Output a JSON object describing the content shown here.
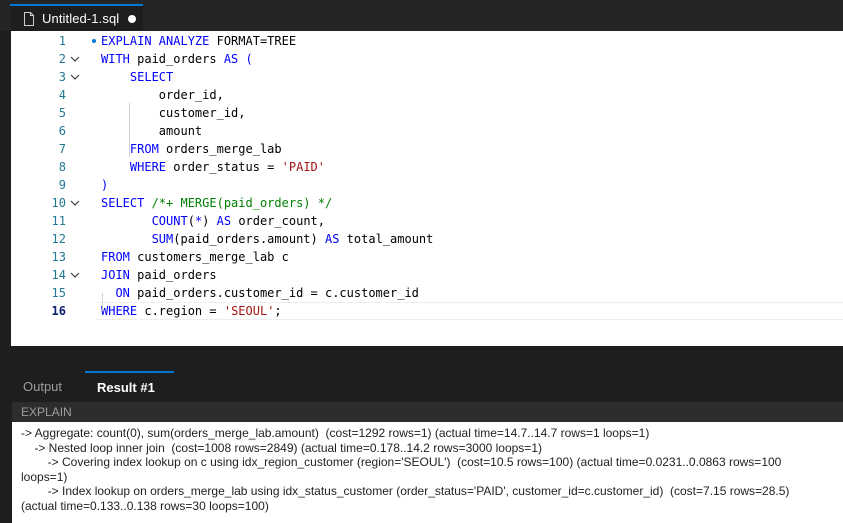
{
  "tab": {
    "title": "Untitled-1.sql",
    "icon": "file-icon",
    "dirty": true
  },
  "editor": {
    "lines": [
      {
        "num": "1",
        "tokens": [
          [
            "kw",
            "EXPLAIN ANALYZE "
          ],
          [
            "",
            "FORMAT=TREE"
          ]
        ]
      },
      {
        "num": "2",
        "tokens": [
          [
            "kw",
            "WITH "
          ],
          [
            "",
            "paid_orders "
          ],
          [
            "kw",
            "AS ("
          ]
        ]
      },
      {
        "num": "3",
        "tokens": [
          [
            "",
            "    "
          ],
          [
            "kw",
            "SELECT"
          ]
        ]
      },
      {
        "num": "4",
        "tokens": [
          [
            "",
            "        order_id,"
          ]
        ]
      },
      {
        "num": "5",
        "tokens": [
          [
            "",
            "        customer_id,"
          ]
        ]
      },
      {
        "num": "6",
        "tokens": [
          [
            "",
            "        amount"
          ]
        ]
      },
      {
        "num": "7",
        "tokens": [
          [
            "",
            "    "
          ],
          [
            "kw",
            "FROM "
          ],
          [
            "",
            "orders_merge_lab"
          ]
        ]
      },
      {
        "num": "8",
        "tokens": [
          [
            "",
            "    "
          ],
          [
            "kw",
            "WHERE "
          ],
          [
            "",
            "order_status = "
          ],
          [
            "str",
            "'PAID'"
          ]
        ]
      },
      {
        "num": "9",
        "tokens": [
          [
            "kw",
            ")"
          ]
        ]
      },
      {
        "num": "10",
        "tokens": [
          [
            "kw",
            "SELECT "
          ],
          [
            "cmt",
            "/*+ MERGE(paid_orders) */"
          ]
        ]
      },
      {
        "num": "11",
        "tokens": [
          [
            "",
            "       "
          ],
          [
            "kw",
            "COUNT"
          ],
          [
            "",
            "("
          ],
          [
            "kw",
            "*"
          ],
          [
            "",
            ") "
          ],
          [
            "kw",
            "AS "
          ],
          [
            "",
            "order_count,"
          ]
        ]
      },
      {
        "num": "12",
        "tokens": [
          [
            "",
            "       "
          ],
          [
            "kw",
            "SUM"
          ],
          [
            "",
            "(paid_orders.amount) "
          ],
          [
            "kw",
            "AS "
          ],
          [
            "",
            "total_amount"
          ]
        ]
      },
      {
        "num": "13",
        "tokens": [
          [
            "kw",
            "FROM "
          ],
          [
            "",
            "customers_merge_lab c"
          ]
        ]
      },
      {
        "num": "14",
        "tokens": [
          [
            "kw",
            "JOIN "
          ],
          [
            "",
            "paid_orders"
          ]
        ]
      },
      {
        "num": "15",
        "tokens": [
          [
            "",
            "  "
          ],
          [
            "kw",
            "ON "
          ],
          [
            "",
            "paid_orders.customer_id = c.customer_id"
          ]
        ]
      },
      {
        "num": "16",
        "tokens": [
          [
            "kw",
            "WHERE "
          ],
          [
            "",
            "c.region = "
          ],
          [
            "str",
            "'SEOUL'"
          ],
          [
            "",
            ";"
          ]
        ]
      }
    ],
    "fold_lines": [
      "2",
      "3",
      "10",
      "14"
    ],
    "active_line": "16"
  },
  "panel": {
    "tabs": [
      {
        "label": "Output"
      },
      {
        "label": "Result #1"
      }
    ],
    "column": "EXPLAIN",
    "plan": "-> Aggregate: count(0), sum(orders_merge_lab.amount)  (cost=1292 rows=1) (actual time=14.7..14.7 rows=1 loops=1)\n    -> Nested loop inner join  (cost=1008 rows=2849) (actual time=0.178..14.2 rows=3000 loops=1)\n        -> Covering index lookup on c using idx_region_customer (region='SEOUL')  (cost=10.5 rows=100) (actual time=0.0231..0.0863 rows=100 loops=1)\n        -> Index lookup on orders_merge_lab using idx_status_customer (order_status='PAID', customer_id=c.customer_id)  (cost=7.15 rows=28.5) (actual time=0.133..0.138 rows=30 loops=100)"
  },
  "colors": {
    "accent": "#0078d4",
    "keyword": "#0000ff",
    "string": "#a31515",
    "comment": "#008000",
    "line_number": "#237893"
  }
}
